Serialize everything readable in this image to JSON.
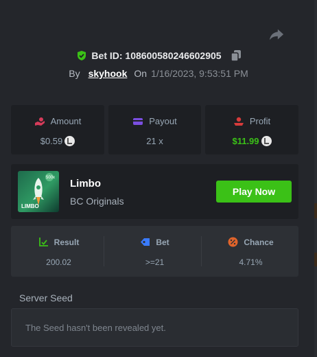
{
  "header": {
    "bet_id": "Bet ID: 108600580246602905",
    "by_label": "By",
    "username": "skyhook",
    "on_label": "On",
    "datetime": "1/16/2023, 9:53:51 PM"
  },
  "stats": {
    "amount": {
      "label": "Amount",
      "value": "$0.59"
    },
    "payout": {
      "label": "Payout",
      "value": "21 x"
    },
    "profit": {
      "label": "Profit",
      "value": "$11.99"
    }
  },
  "game": {
    "title": "Limbo",
    "subtitle": "BC Originals",
    "thumbnail_text": "LIMBO",
    "thumbnail_badge": "500x",
    "play_button": "Play Now"
  },
  "result": {
    "result": {
      "label": "Result",
      "value": "200.02"
    },
    "bet": {
      "label": "Bet",
      "value": ">=21"
    },
    "chance": {
      "label": "Chance",
      "value": "4.71%"
    }
  },
  "seed": {
    "label": "Server Seed",
    "text": "The Seed hasn't been revealed yet."
  },
  "colors": {
    "background": "#24262b",
    "card": "#1d1f23",
    "accent_green": "#3bc117",
    "text_muted": "#98a7b5"
  },
  "icons": {
    "share": "share-arrow-icon",
    "shield": "shield-check-icon",
    "copy": "copy-icon",
    "amount": "hand-coin-icon",
    "payout": "card-icon",
    "profit": "hand-coin-icon",
    "result": "chart-check-icon",
    "bet": "tag-icon",
    "chance": "percent-icon"
  }
}
